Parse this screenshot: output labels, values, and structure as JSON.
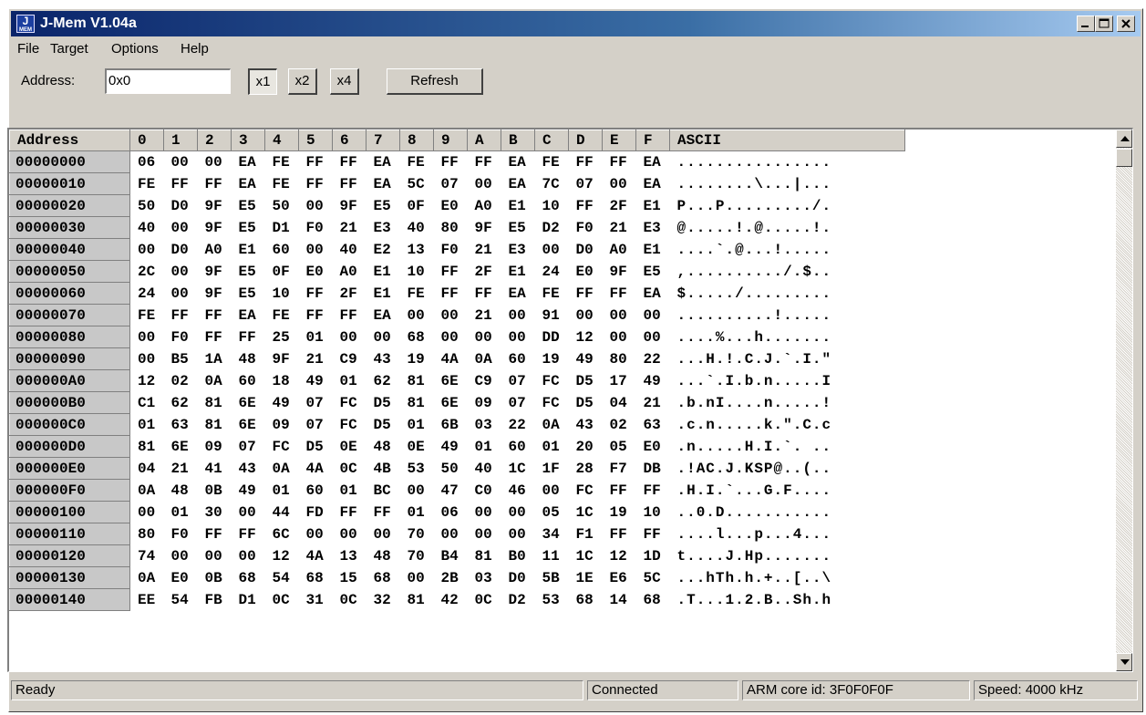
{
  "window": {
    "title": "J-Mem V1.04a",
    "icon_text_top": "J",
    "icon_text_bottom": "MEM"
  },
  "menu": [
    "File",
    "Target",
    "Options",
    "Help"
  ],
  "toolbar": {
    "address_label": "Address:",
    "address_value": "0x0",
    "zoom_buttons": [
      "x1",
      "x2",
      "x4"
    ],
    "refresh_label": "Refresh"
  },
  "grid": {
    "headers": [
      "Address",
      "0",
      "1",
      "2",
      "3",
      "4",
      "5",
      "6",
      "7",
      "8",
      "9",
      "A",
      "B",
      "C",
      "D",
      "E",
      "F",
      "ASCII"
    ],
    "rows": [
      {
        "addr": "00000000",
        "bytes": [
          "06",
          "00",
          "00",
          "EA",
          "FE",
          "FF",
          "FF",
          "EA",
          "FE",
          "FF",
          "FF",
          "EA",
          "FE",
          "FF",
          "FF",
          "EA"
        ],
        "ascii": "................"
      },
      {
        "addr": "00000010",
        "bytes": [
          "FE",
          "FF",
          "FF",
          "EA",
          "FE",
          "FF",
          "FF",
          "EA",
          "5C",
          "07",
          "00",
          "EA",
          "7C",
          "07",
          "00",
          "EA"
        ],
        "ascii": "........\\...|..."
      },
      {
        "addr": "00000020",
        "bytes": [
          "50",
          "D0",
          "9F",
          "E5",
          "50",
          "00",
          "9F",
          "E5",
          "0F",
          "E0",
          "A0",
          "E1",
          "10",
          "FF",
          "2F",
          "E1"
        ],
        "ascii": "P...P........./."
      },
      {
        "addr": "00000030",
        "bytes": [
          "40",
          "00",
          "9F",
          "E5",
          "D1",
          "F0",
          "21",
          "E3",
          "40",
          "80",
          "9F",
          "E5",
          "D2",
          "F0",
          "21",
          "E3"
        ],
        "ascii": "@.....!.@.....!."
      },
      {
        "addr": "00000040",
        "bytes": [
          "00",
          "D0",
          "A0",
          "E1",
          "60",
          "00",
          "40",
          "E2",
          "13",
          "F0",
          "21",
          "E3",
          "00",
          "D0",
          "A0",
          "E1"
        ],
        "ascii": "....`.@...!....."
      },
      {
        "addr": "00000050",
        "bytes": [
          "2C",
          "00",
          "9F",
          "E5",
          "0F",
          "E0",
          "A0",
          "E1",
          "10",
          "FF",
          "2F",
          "E1",
          "24",
          "E0",
          "9F",
          "E5"
        ],
        "ascii": ",........../.$.."
      },
      {
        "addr": "00000060",
        "bytes": [
          "24",
          "00",
          "9F",
          "E5",
          "10",
          "FF",
          "2F",
          "E1",
          "FE",
          "FF",
          "FF",
          "EA",
          "FE",
          "FF",
          "FF",
          "EA"
        ],
        "ascii": "$...../........."
      },
      {
        "addr": "00000070",
        "bytes": [
          "FE",
          "FF",
          "FF",
          "EA",
          "FE",
          "FF",
          "FF",
          "EA",
          "00",
          "00",
          "21",
          "00",
          "91",
          "00",
          "00",
          "00"
        ],
        "ascii": "..........!....."
      },
      {
        "addr": "00000080",
        "bytes": [
          "00",
          "F0",
          "FF",
          "FF",
          "25",
          "01",
          "00",
          "00",
          "68",
          "00",
          "00",
          "00",
          "DD",
          "12",
          "00",
          "00"
        ],
        "ascii": "....%...h......."
      },
      {
        "addr": "00000090",
        "bytes": [
          "00",
          "B5",
          "1A",
          "48",
          "9F",
          "21",
          "C9",
          "43",
          "19",
          "4A",
          "0A",
          "60",
          "19",
          "49",
          "80",
          "22"
        ],
        "ascii": "...H.!.C.J.`.I.\""
      },
      {
        "addr": "000000A0",
        "bytes": [
          "12",
          "02",
          "0A",
          "60",
          "18",
          "49",
          "01",
          "62",
          "81",
          "6E",
          "C9",
          "07",
          "FC",
          "D5",
          "17",
          "49"
        ],
        "ascii": "...`.I.b.n.....I"
      },
      {
        "addr": "000000B0",
        "bytes": [
          "C1",
          "62",
          "81",
          "6E",
          "49",
          "07",
          "FC",
          "D5",
          "81",
          "6E",
          "09",
          "07",
          "FC",
          "D5",
          "04",
          "21"
        ],
        "ascii": ".b.nI....n.....!"
      },
      {
        "addr": "000000C0",
        "bytes": [
          "01",
          "63",
          "81",
          "6E",
          "09",
          "07",
          "FC",
          "D5",
          "01",
          "6B",
          "03",
          "22",
          "0A",
          "43",
          "02",
          "63"
        ],
        "ascii": ".c.n.....k.\".C.c"
      },
      {
        "addr": "000000D0",
        "bytes": [
          "81",
          "6E",
          "09",
          "07",
          "FC",
          "D5",
          "0E",
          "48",
          "0E",
          "49",
          "01",
          "60",
          "01",
          "20",
          "05",
          "E0"
        ],
        "ascii": ".n.....H.I.`. .."
      },
      {
        "addr": "000000E0",
        "bytes": [
          "04",
          "21",
          "41",
          "43",
          "0A",
          "4A",
          "0C",
          "4B",
          "53",
          "50",
          "40",
          "1C",
          "1F",
          "28",
          "F7",
          "DB"
        ],
        "ascii": ".!AC.J.KSP@..(.."
      },
      {
        "addr": "000000F0",
        "bytes": [
          "0A",
          "48",
          "0B",
          "49",
          "01",
          "60",
          "01",
          "BC",
          "00",
          "47",
          "C0",
          "46",
          "00",
          "FC",
          "FF",
          "FF"
        ],
        "ascii": ".H.I.`...G.F...."
      },
      {
        "addr": "00000100",
        "bytes": [
          "00",
          "01",
          "30",
          "00",
          "44",
          "FD",
          "FF",
          "FF",
          "01",
          "06",
          "00",
          "00",
          "05",
          "1C",
          "19",
          "10"
        ],
        "ascii": "..0.D..........."
      },
      {
        "addr": "00000110",
        "bytes": [
          "80",
          "F0",
          "FF",
          "FF",
          "6C",
          "00",
          "00",
          "00",
          "70",
          "00",
          "00",
          "00",
          "34",
          "F1",
          "FF",
          "FF"
        ],
        "ascii": "....l...p...4..."
      },
      {
        "addr": "00000120",
        "bytes": [
          "74",
          "00",
          "00",
          "00",
          "12",
          "4A",
          "13",
          "48",
          "70",
          "B4",
          "81",
          "B0",
          "11",
          "1C",
          "12",
          "1D"
        ],
        "ascii": "t....J.Hp......."
      },
      {
        "addr": "00000130",
        "bytes": [
          "0A",
          "E0",
          "0B",
          "68",
          "54",
          "68",
          "15",
          "68",
          "00",
          "2B",
          "03",
          "D0",
          "5B",
          "1E",
          "E6",
          "5C"
        ],
        "ascii": "...hTh.h.+..[..\\"
      },
      {
        "addr": "00000140",
        "bytes": [
          "EE",
          "54",
          "FB",
          "D1",
          "0C",
          "31",
          "0C",
          "32",
          "81",
          "42",
          "0C",
          "D2",
          "53",
          "68",
          "14",
          "68"
        ],
        "ascii": ".T...1.2.B..Sh.h"
      }
    ]
  },
  "status": {
    "state": "Ready",
    "connection": "Connected",
    "core_id": "ARM core id: 3F0F0F0F",
    "speed": "Speed: 4000 kHz"
  },
  "colors": {
    "title_start": "#0a246a",
    "title_end": "#a6caf0",
    "face": "#d4d0c8",
    "address_cell": "#c8c8c8"
  }
}
